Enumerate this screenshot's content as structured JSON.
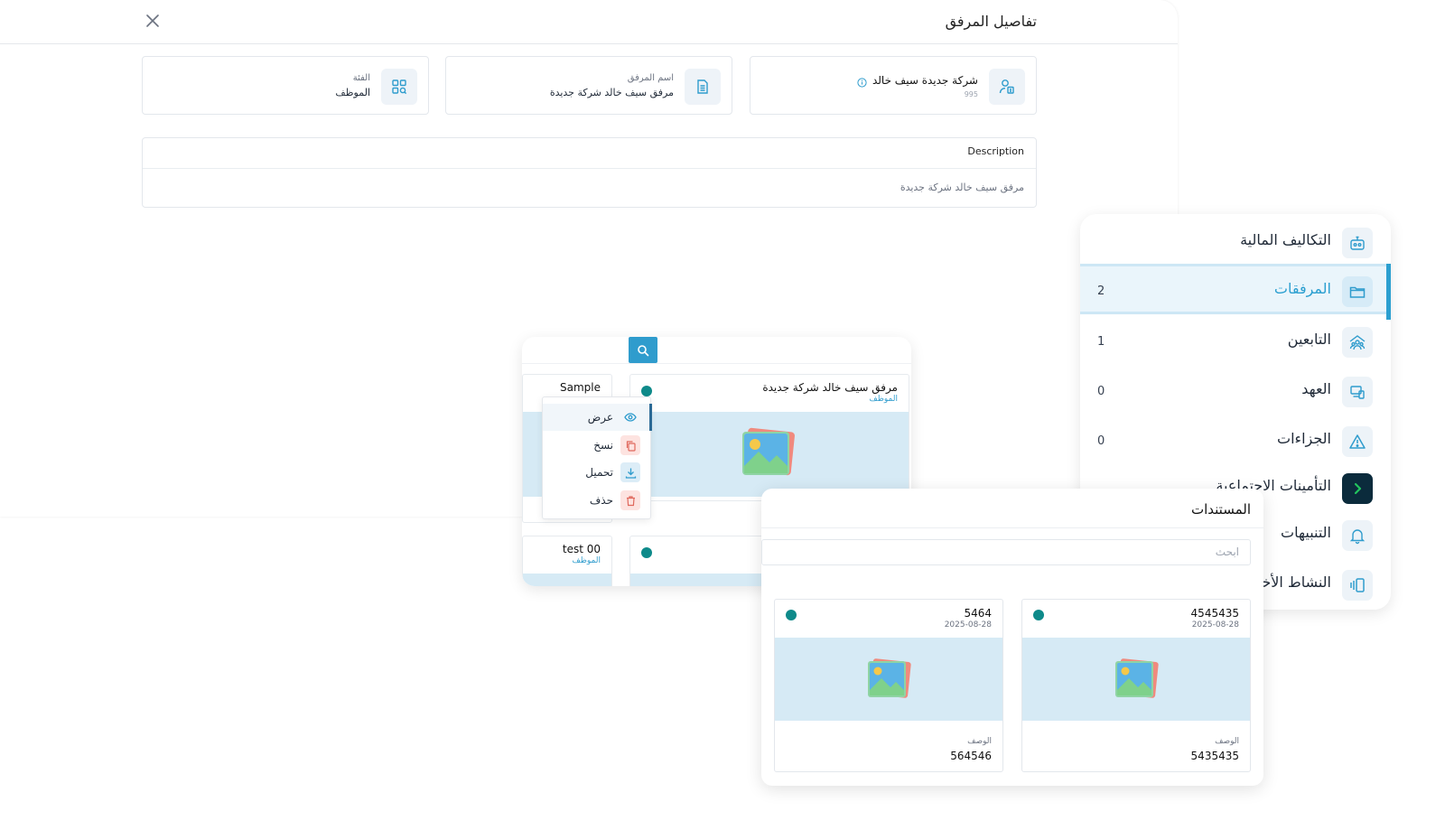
{
  "dialog": {
    "title": "تفاصيل المرفق",
    "company": {
      "name": "شركة جديدة سيف خالد",
      "code": "995"
    },
    "attachment": {
      "label": "اسم المرفق",
      "value": "مرفق سيف خالد شركة جديدة"
    },
    "category": {
      "label": "الفئة",
      "value": "الموظف"
    },
    "description": {
      "label": "Description",
      "value": "مرفق سيف خالد شركة جديدة"
    }
  },
  "side_tabs": [
    {
      "label": "التكاليف المالية",
      "count": "",
      "icon": "robot-icon"
    },
    {
      "label": "المرفقات",
      "count": "2",
      "icon": "folder-icon",
      "active": true
    },
    {
      "label": "التابعين",
      "count": "1",
      "icon": "family-icon"
    },
    {
      "label": "العهد",
      "count": "0",
      "icon": "device-icon"
    },
    {
      "label": "الجزاءات",
      "count": "0",
      "icon": "warning-icon"
    },
    {
      "label": "التأمينات الاجتماعية",
      "count": "",
      "icon": "arrow-icon"
    },
    {
      "label": "التنبيهات",
      "count": "",
      "icon": "bell-icon"
    },
    {
      "label": "النشاط الأخير",
      "count": "",
      "icon": "activity-icon"
    }
  ],
  "attachments": {
    "cards": [
      {
        "title": "مرفق سيف خالد شركة جديدة",
        "category": "الموظف"
      },
      {
        "title": "Sample",
        "category": ""
      },
      {
        "title": "test 00",
        "category": "الموظف"
      }
    ],
    "menu": [
      {
        "label": "عرض",
        "icon": "eye-icon"
      },
      {
        "label": "نسخ",
        "icon": "copy-icon"
      },
      {
        "label": "تحميل",
        "icon": "download-icon"
      },
      {
        "label": "حذف",
        "icon": "trash-icon"
      }
    ]
  },
  "documents": {
    "title": "المستندات",
    "search_placeholder": "ابحث",
    "cards": [
      {
        "title": "4545435",
        "date": "2025-08-28",
        "desc_label": "الوصف",
        "desc_value": "5435435"
      },
      {
        "title": "5464",
        "date": "2025-08-28",
        "desc_label": "الوصف",
        "desc_value": "564546"
      }
    ]
  },
  "colors": {
    "accent": "#2b9fd0",
    "teal_dot": "#0e8a8a",
    "thumb_bg": "#d6eaf5",
    "dark_icon": "#0b2b3c"
  }
}
